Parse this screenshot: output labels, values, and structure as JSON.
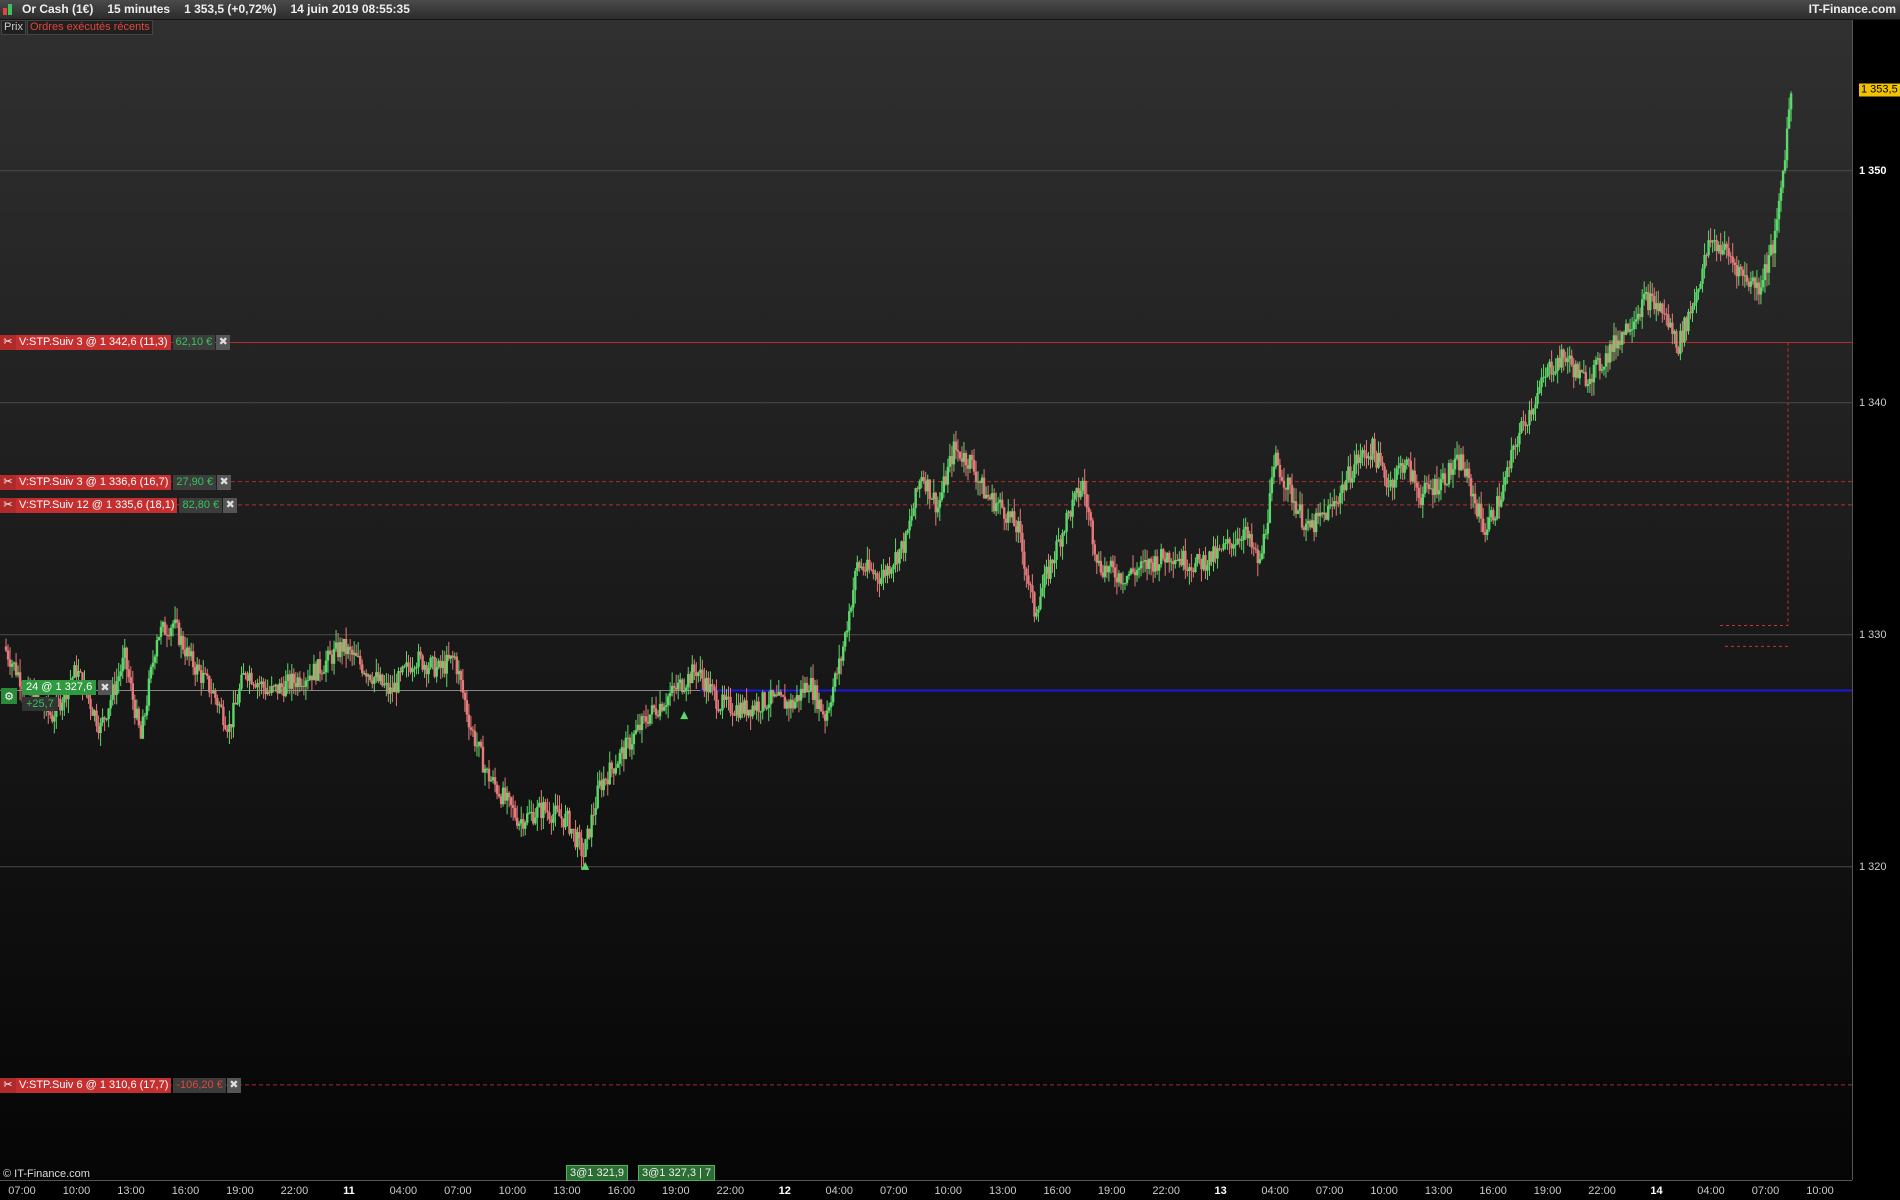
{
  "window": {
    "instrument": "Or Cash (1€)",
    "timeframe": "15 minutes",
    "last_quote": "1 353,5 (+0,72%)",
    "timestamp": "14 juin 2019 08:55:35",
    "brand": "IT-Finance.com"
  },
  "tabs": [
    "Prix",
    "Ordres exécutés récents"
  ],
  "copyright": "© IT-Finance.com",
  "orders": [
    {
      "label": "V:STP.Suiv  3 @ 1 342,6 (11,3)",
      "pl": "62,10 €",
      "pl_sign": "pos",
      "price": 1342.6,
      "line": "solid"
    },
    {
      "label": "V:STP.Suiv  3 @ 1 336,6 (16,7)",
      "pl": "27,90 €",
      "pl_sign": "pos",
      "price": 1336.6,
      "line": "dashed"
    },
    {
      "label": "V:STP.Suiv  12 @ 1 335,6 (18,1)",
      "pl": "82,80 €",
      "pl_sign": "pos",
      "price": 1335.6,
      "line": "dashed"
    },
    {
      "label": "V:STP.Suiv  6 @ 1 310,6 (17,7)",
      "pl": "-106,20 €",
      "pl_sign": "neg",
      "price": 1310.6,
      "line": "dashed"
    }
  ],
  "position": {
    "label": "24 @ 1 327,6",
    "pl": "+25,7",
    "price": 1327.6
  },
  "fills": [
    {
      "label": "3@1 321,9"
    },
    {
      "label": "3@1 327,3 | 7"
    }
  ],
  "colors": {
    "up": "#5cd86a",
    "down": "#e47a7a",
    "position_line": "#1a1ad8",
    "order_line": "#c83232",
    "last_price_tag": "#f2c200"
  },
  "chart_data": {
    "type": "candlestick",
    "title": "",
    "xlabel": "",
    "ylabel": "",
    "ylim": [
      1306.5,
      1356.5
    ],
    "y_ticks": [
      1320,
      1330,
      1340,
      1350
    ],
    "y_tick_labels": [
      "1 320",
      "1 330",
      "1 340",
      "1 350"
    ],
    "last_price": 1353.5,
    "last_price_label": "1 353,5",
    "x_tick_labels": [
      "07:00",
      "10:00",
      "13:00",
      "16:00",
      "19:00",
      "22:00",
      "11",
      "04:00",
      "07:00",
      "10:00",
      "13:00",
      "16:00",
      "19:00",
      "22:00",
      "12",
      "04:00",
      "07:00",
      "10:00",
      "13:00",
      "16:00",
      "19:00",
      "22:00",
      "13",
      "04:00",
      "07:00",
      "10:00",
      "13:00",
      "16:00",
      "19:00",
      "22:00",
      "14",
      "04:00",
      "07:00",
      "10:00"
    ],
    "day_labels": [
      "11",
      "12",
      "13",
      "14"
    ],
    "close_path": [
      {
        "t": 0,
        "v": 1329.5
      },
      {
        "t": 3,
        "v": 1327.5
      },
      {
        "t": 6,
        "v": 1326.5
      },
      {
        "t": 9,
        "v": 1328.5
      },
      {
        "t": 12,
        "v": 1326.0
      },
      {
        "t": 15,
        "v": 1329.0
      },
      {
        "t": 17,
        "v": 1325.5
      },
      {
        "t": 19,
        "v": 1330.0
      },
      {
        "t": 21,
        "v": 1330.5
      },
      {
        "t": 23,
        "v": 1329.0
      },
      {
        "t": 26,
        "v": 1327.5
      },
      {
        "t": 28,
        "v": 1326.0
      },
      {
        "t": 30,
        "v": 1328.5
      },
      {
        "t": 33,
        "v": 1327.5
      },
      {
        "t": 36,
        "v": 1328.0
      },
      {
        "t": 39,
        "v": 1328.5
      },
      {
        "t": 42,
        "v": 1329.5
      },
      {
        "t": 45,
        "v": 1328.5
      },
      {
        "t": 48,
        "v": 1327.5
      },
      {
        "t": 51,
        "v": 1329.0
      },
      {
        "t": 54,
        "v": 1328.5
      },
      {
        "t": 56,
        "v": 1329.0
      },
      {
        "t": 58,
        "v": 1326.0
      },
      {
        "t": 60,
        "v": 1324.0
      },
      {
        "t": 62,
        "v": 1323.0
      },
      {
        "t": 64,
        "v": 1322.0
      },
      {
        "t": 67,
        "v": 1322.5
      },
      {
        "t": 70,
        "v": 1322.0
      },
      {
        "t": 72,
        "v": 1320.5
      },
      {
        "t": 74,
        "v": 1323.5
      },
      {
        "t": 77,
        "v": 1325.0
      },
      {
        "t": 80,
        "v": 1326.5
      },
      {
        "t": 83,
        "v": 1327.5
      },
      {
        "t": 86,
        "v": 1328.5
      },
      {
        "t": 89,
        "v": 1327.0
      },
      {
        "t": 92,
        "v": 1326.8
      },
      {
        "t": 95,
        "v": 1327.2
      },
      {
        "t": 98,
        "v": 1327.0
      },
      {
        "t": 100,
        "v": 1328.0
      },
      {
        "t": 102,
        "v": 1326.5
      },
      {
        "t": 104,
        "v": 1329.0
      },
      {
        "t": 106,
        "v": 1333.0
      },
      {
        "t": 109,
        "v": 1332.5
      },
      {
        "t": 112,
        "v": 1334.0
      },
      {
        "t": 114,
        "v": 1337.0
      },
      {
        "t": 116,
        "v": 1335.5
      },
      {
        "t": 118,
        "v": 1338.0
      },
      {
        "t": 120,
        "v": 1337.5
      },
      {
        "t": 122,
        "v": 1336.0
      },
      {
        "t": 124,
        "v": 1335.5
      },
      {
        "t": 126,
        "v": 1334.5
      },
      {
        "t": 128,
        "v": 1331.0
      },
      {
        "t": 130,
        "v": 1333.0
      },
      {
        "t": 132,
        "v": 1335.0
      },
      {
        "t": 134,
        "v": 1336.5
      },
      {
        "t": 136,
        "v": 1333.0
      },
      {
        "t": 139,
        "v": 1332.5
      },
      {
        "t": 142,
        "v": 1333.0
      },
      {
        "t": 145,
        "v": 1333.5
      },
      {
        "t": 148,
        "v": 1333.0
      },
      {
        "t": 151,
        "v": 1333.5
      },
      {
        "t": 154,
        "v": 1334.5
      },
      {
        "t": 156,
        "v": 1333.0
      },
      {
        "t": 158,
        "v": 1337.5
      },
      {
        "t": 160,
        "v": 1336.0
      },
      {
        "t": 162,
        "v": 1334.5
      },
      {
        "t": 165,
        "v": 1335.5
      },
      {
        "t": 168,
        "v": 1337.5
      },
      {
        "t": 170,
        "v": 1338.0
      },
      {
        "t": 172,
        "v": 1336.5
      },
      {
        "t": 174,
        "v": 1337.5
      },
      {
        "t": 176,
        "v": 1336.0
      },
      {
        "t": 178,
        "v": 1336.5
      },
      {
        "t": 181,
        "v": 1337.5
      },
      {
        "t": 184,
        "v": 1334.5
      },
      {
        "t": 186,
        "v": 1336.0
      },
      {
        "t": 188,
        "v": 1338.5
      },
      {
        "t": 190,
        "v": 1340.0
      },
      {
        "t": 192,
        "v": 1341.5
      },
      {
        "t": 194,
        "v": 1342.0
      },
      {
        "t": 196,
        "v": 1341.0
      },
      {
        "t": 198,
        "v": 1341.5
      },
      {
        "t": 200,
        "v": 1342.5
      },
      {
        "t": 202,
        "v": 1343.5
      },
      {
        "t": 204,
        "v": 1344.5
      },
      {
        "t": 206,
        "v": 1344.0
      },
      {
        "t": 208,
        "v": 1342.5
      },
      {
        "t": 210,
        "v": 1344.5
      },
      {
        "t": 212,
        "v": 1347.0
      },
      {
        "t": 214,
        "v": 1346.5
      },
      {
        "t": 216,
        "v": 1345.5
      },
      {
        "t": 218,
        "v": 1345.0
      },
      {
        "t": 220,
        "v": 1347.0
      },
      {
        "t": 221,
        "v": 1350.0
      },
      {
        "t": 222,
        "v": 1353.5
      }
    ]
  }
}
